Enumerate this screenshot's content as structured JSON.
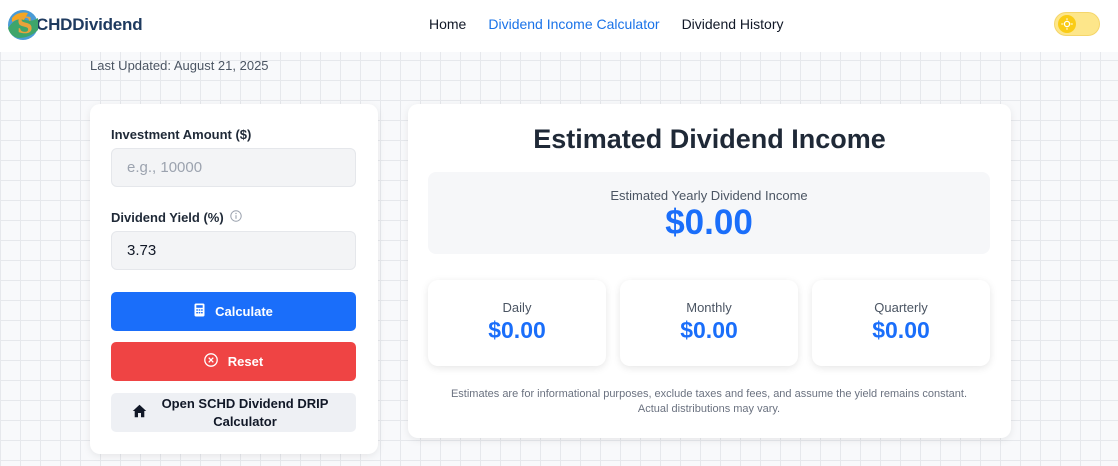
{
  "brand": {
    "name": "SCHDDividend",
    "logo_letter": "S",
    "logo_rest": "CHD",
    "logo_word": "Dividend"
  },
  "nav": {
    "links": [
      {
        "label": "Home"
      },
      {
        "label": "Dividend Income Calculator",
        "active": true
      },
      {
        "label": "Dividend History"
      }
    ],
    "theme_toggle": "sun-icon"
  },
  "last_updated": "Last Updated: August 21, 2025",
  "form": {
    "investment_label": "Investment Amount ($)",
    "investment_placeholder": "e.g., 10000",
    "investment_value": "",
    "yield_label": "Dividend Yield (%)",
    "yield_value": "3.73",
    "calculate_label": "Calculate",
    "reset_label": "Reset",
    "drip_label": "Open SCHD Dividend DRIP Calculator"
  },
  "results": {
    "title": "Estimated Dividend Income",
    "yearly_label": "Estimated Yearly Dividend Income",
    "yearly_value": "$0.00",
    "breakdown": [
      {
        "label": "Daily",
        "value": "$0.00"
      },
      {
        "label": "Monthly",
        "value": "$0.00"
      },
      {
        "label": "Quarterly",
        "value": "$0.00"
      }
    ],
    "disclaimer_line1": "Estimates are for informational purposes, exclude taxes and fees, and assume the yield remains constant.",
    "disclaimer_line2": "Actual distributions may vary."
  },
  "colors": {
    "accent": "#1a6efa",
    "danger": "#ef4444",
    "brand_text": "#1e3a5f"
  }
}
